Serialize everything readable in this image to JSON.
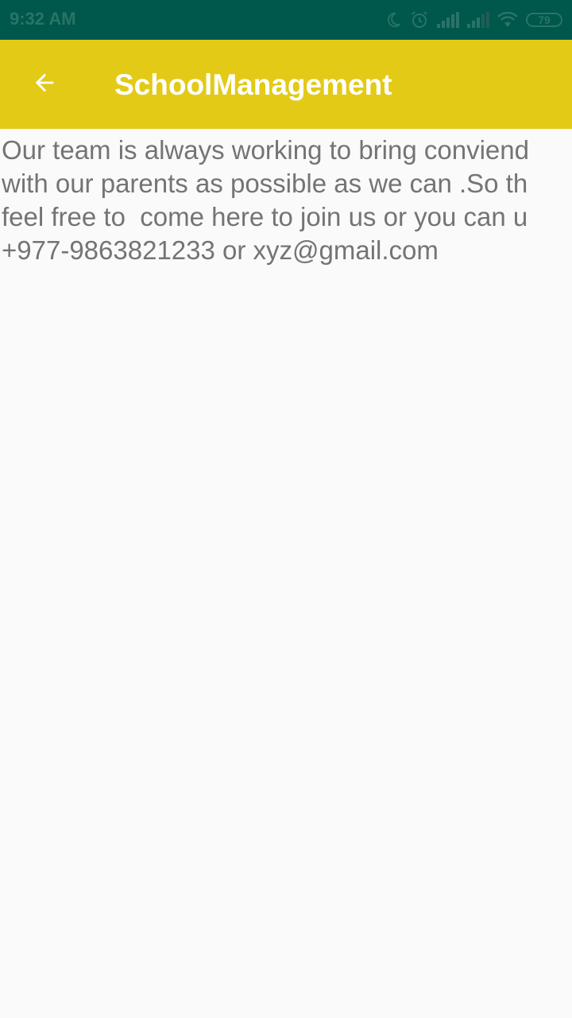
{
  "status_bar": {
    "time": "9:32 AM",
    "icons": [
      "moon-icon",
      "alarm-icon",
      "signal-icon",
      "signal-icon",
      "wifi-icon",
      "battery-icon"
    ],
    "battery_level": "79"
  },
  "app_bar": {
    "title": "SchoolManagement",
    "back_icon": "arrow-back-icon",
    "background_color": "#e2ca17"
  },
  "content": {
    "lines": [
      "Our team is always working to bring conviend",
      "with our parents as possible as we can .So th",
      "feel free to  come here to join us or you can u",
      "+977-9863821233 or xyz@gmail.com"
    ]
  },
  "colors": {
    "status_bar": "#00574b",
    "app_bar": "#e2ca17",
    "background": "#fafafa",
    "text": "#747474"
  }
}
